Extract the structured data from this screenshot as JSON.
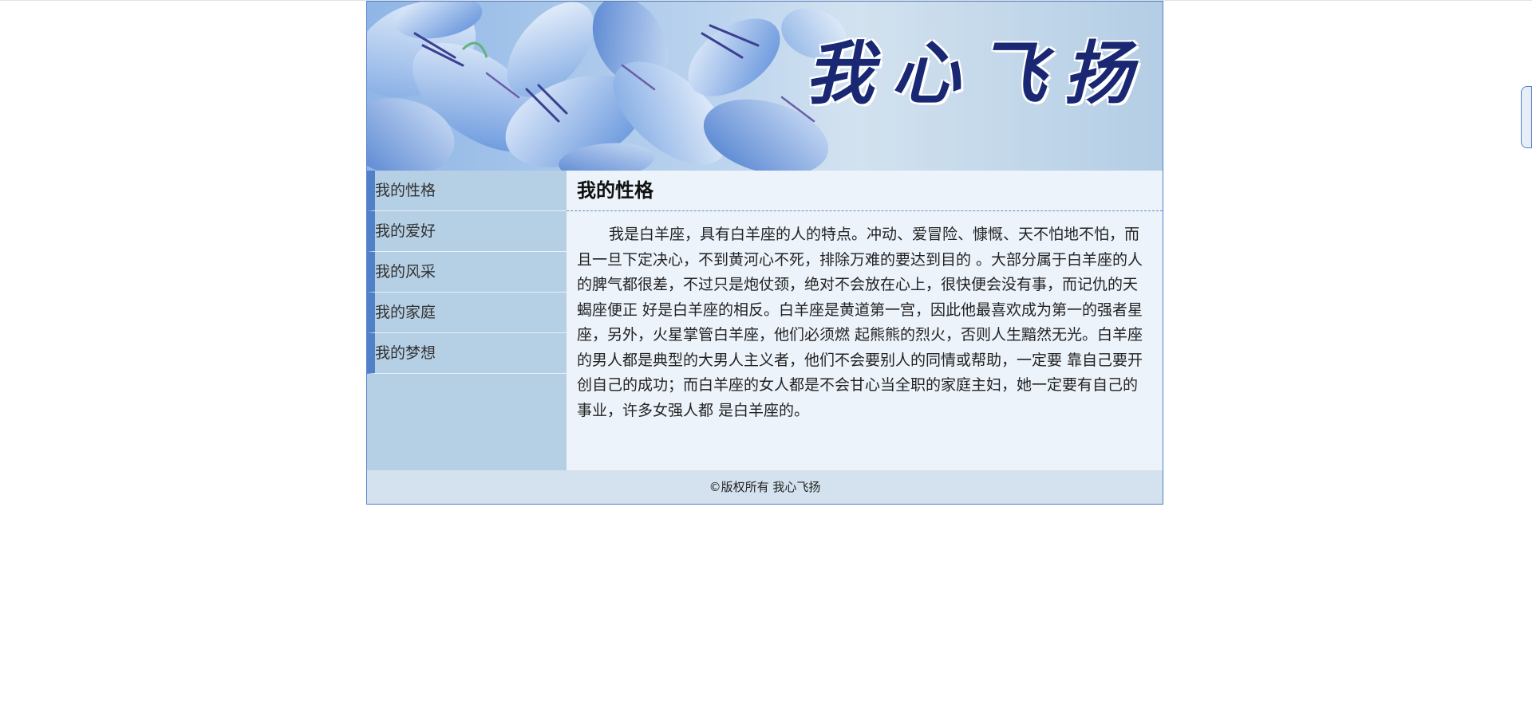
{
  "site": {
    "logo_text": "我心飞扬"
  },
  "sidebar": {
    "items": [
      {
        "label": "我的性格"
      },
      {
        "label": "我的爱好"
      },
      {
        "label": "我的风采"
      },
      {
        "label": "我的家庭"
      },
      {
        "label": "我的梦想"
      }
    ]
  },
  "main": {
    "title": "我的性格",
    "body": "我是白羊座，具有白羊座的人的特点。冲动、爱冒险、慷慨、天不怕地不怕，而且一旦下定决心，不到黄河心不死，排除万难的要达到目的 。大部分属于白羊座的人的脾气都很差，不过只是炮仗颈，绝对不会放在心上，很快便会没有事，而记仇的天蝎座便正 好是白羊座的相反。白羊座是黄道第一宫，因此他最喜欢成为第一的强者星座，另外，火星掌管白羊座，他们必须燃 起熊熊的烈火，否则人生黯然无光。白羊座的男人都是典型的大男人主义者，他们不会要别人的同情或帮助，一定要 靠自己要开创自己的成功；而白羊座的女人都是不会甘心当全职的家庭主妇，她一定要有自己的事业，许多女强人都 是白羊座的。"
  },
  "footer": {
    "copyright": "©版权所有 我心飞扬"
  },
  "colors": {
    "border": "#4f80c8",
    "sidebar_bg": "#b5cfe4",
    "content_bg": "#edf3fb",
    "footer_bg": "#d3e2ee",
    "logo": "#1a2874"
  }
}
